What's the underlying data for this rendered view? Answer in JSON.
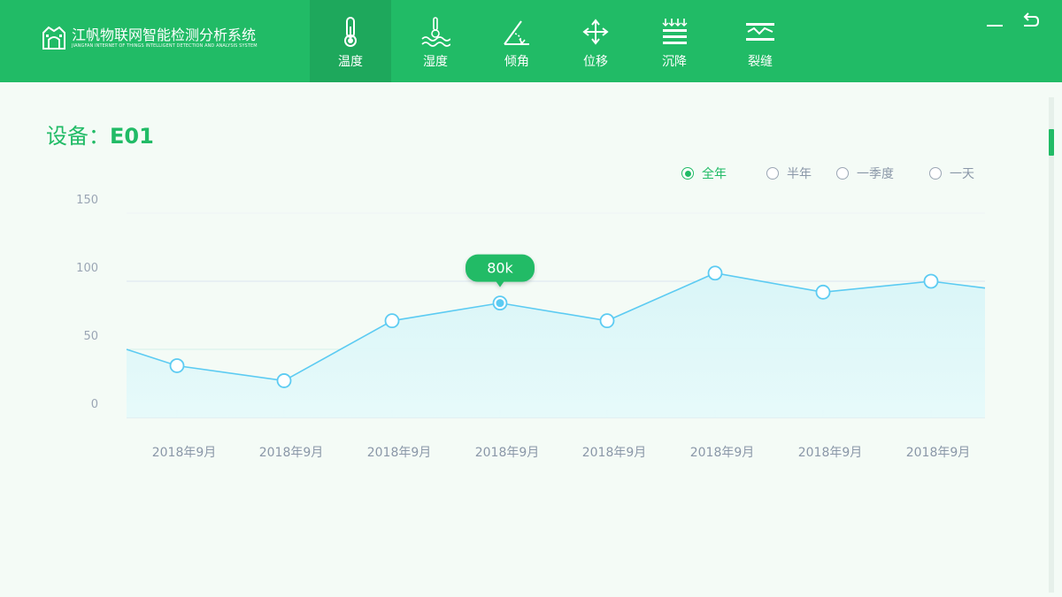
{
  "app": {
    "title_cn": "江帆物联网智能检测分析系统",
    "title_en": "JIANGFAN INTERNET OF THINGS INTELLIGENT DETECTION AND ANALYSIS SYSTEM"
  },
  "nav": [
    {
      "label": "温度",
      "icon": "thermometer-icon",
      "active": true
    },
    {
      "label": "湿度",
      "icon": "humidity-icon",
      "active": false
    },
    {
      "label": "倾角",
      "icon": "angle-icon",
      "active": false
    },
    {
      "label": "位移",
      "icon": "move-arrows-icon",
      "active": false
    },
    {
      "label": "沉降",
      "icon": "settlement-icon",
      "active": false
    },
    {
      "label": "裂缝",
      "icon": "crack-icon",
      "active": false
    }
  ],
  "window_controls": {
    "minimize": "minimize-icon",
    "back": "back-icon"
  },
  "device": {
    "label": "设备：",
    "value": "E01"
  },
  "range_options": [
    {
      "label": "全年",
      "selected": true
    },
    {
      "label": "半年",
      "selected": false
    },
    {
      "label": "一季度",
      "selected": false
    },
    {
      "label": "一天",
      "selected": false
    }
  ],
  "colors": {
    "brand": "#21bb66",
    "line": "#5ccbf2",
    "area": "#e3f8f8"
  },
  "chart_data": {
    "type": "area",
    "categories": [
      "2018年9月",
      "2018年9月",
      "2018年9月",
      "2018年9月",
      "2018年9月",
      "2018年9月",
      "2018年9月",
      "2018年9月"
    ],
    "series": [
      {
        "values": [
          38,
          27,
          71,
          84,
          71,
          106,
          92,
          100
        ]
      }
    ],
    "left_edge_value": 50,
    "right_edge_value": 95,
    "ylim": [
      0,
      150
    ],
    "yticks": [
      0,
      50,
      100,
      150
    ],
    "grid": true,
    "tooltip": {
      "index": 3,
      "text": "80k"
    }
  }
}
